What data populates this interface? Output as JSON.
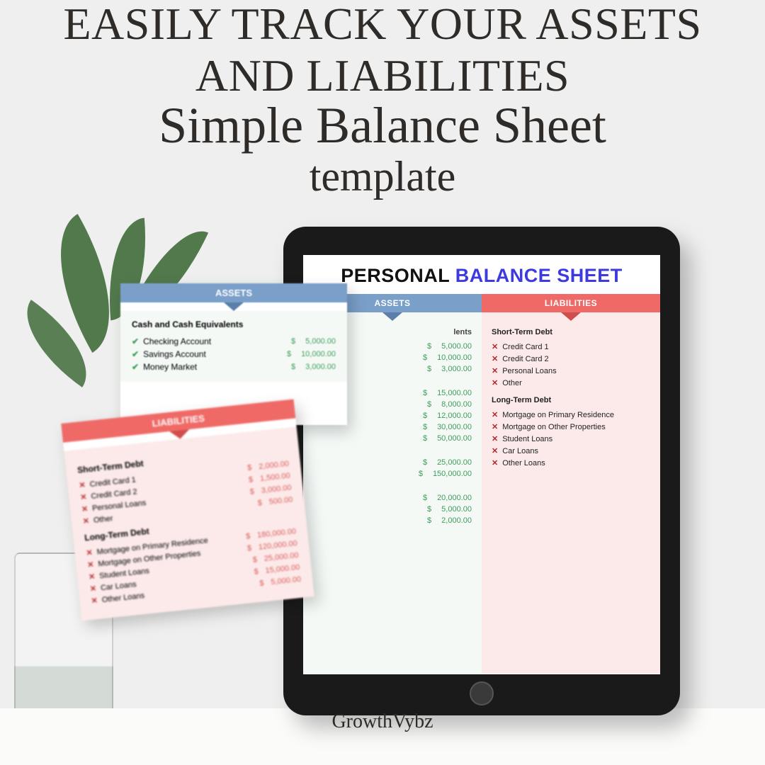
{
  "headline": {
    "line1": "EASILY TRACK YOUR ASSETS",
    "line2": "AND LIABILITIES",
    "sub1": "Simple Balance Sheet",
    "sub2": "template"
  },
  "brand": "GrowthVybz",
  "tablet": {
    "title_part1": "PERSONAL ",
    "title_part2": "BALANCE SHEET",
    "assets": {
      "header": "ASSETS",
      "group1_title_short": "lents",
      "group1": [
        {
          "amt": "5,000.00"
        },
        {
          "amt": "10,000.00"
        },
        {
          "amt": "3,000.00"
        }
      ],
      "group2": [
        {
          "amt": "15,000.00"
        },
        {
          "amt": "8,000.00"
        },
        {
          "amt": "12,000.00"
        },
        {
          "amt": "30,000.00"
        },
        {
          "amt": "50,000.00"
        }
      ],
      "group3": [
        {
          "amt": "25,000.00"
        },
        {
          "amt": "150,000.00"
        }
      ],
      "group4": [
        {
          "amt": "20,000.00"
        },
        {
          "amt": "5,000.00"
        },
        {
          "amt": "2,000.00"
        }
      ]
    },
    "liabilities": {
      "header": "LIABILITIES",
      "short_title": "Short-Term Debt",
      "short": [
        {
          "label": "Credit Card 1"
        },
        {
          "label": "Credit Card 2"
        },
        {
          "label": "Personal Loans"
        },
        {
          "label": "Other"
        }
      ],
      "long_title": "Long-Term Debt",
      "long": [
        {
          "label": "Mortgage on Primary Residence"
        },
        {
          "label": "Mortgage on Other Properties"
        },
        {
          "label": "Student Loans"
        },
        {
          "label": "Car Loans"
        },
        {
          "label": "Other Loans"
        }
      ]
    }
  },
  "assets_card": {
    "header": "ASSETS",
    "group_title": "Cash and Cash Equivalents",
    "items": [
      {
        "label": "Checking Account",
        "amt": "5,000.00"
      },
      {
        "label": "Savings Account",
        "amt": "10,000.00"
      },
      {
        "label": "Money Market",
        "amt": "3,000.00"
      }
    ]
  },
  "liab_card": {
    "header": "LIABILITIES",
    "short_title": "Short-Term Debt",
    "short": [
      {
        "label": "Credit Card 1",
        "amt": "2,000.00"
      },
      {
        "label": "Credit Card 2",
        "amt": "1,500.00"
      },
      {
        "label": "Personal Loans",
        "amt": "3,000.00"
      },
      {
        "label": "Other",
        "amt": "500.00"
      }
    ],
    "long_title": "Long-Term Debt",
    "long": [
      {
        "label": "Mortgage on Primary Residence",
        "amt": "180,000.00"
      },
      {
        "label": "Mortgage on Other Properties",
        "amt": "120,000.00"
      },
      {
        "label": "Student Loans",
        "amt": "25,000.00"
      },
      {
        "label": "Car Loans",
        "amt": "15,000.00"
      },
      {
        "label": "Other Loans",
        "amt": "5,000.00"
      }
    ]
  }
}
